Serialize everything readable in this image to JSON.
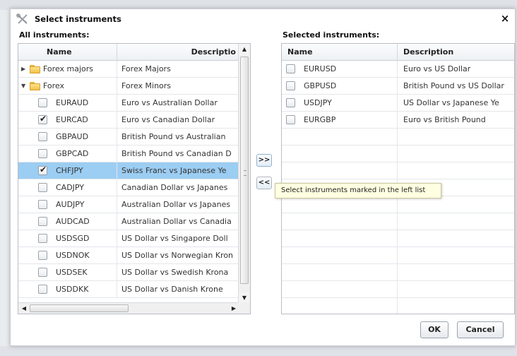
{
  "dialog": {
    "title": "Select instruments",
    "close_label": "×",
    "ok_label": "OK",
    "cancel_label": "Cancel"
  },
  "left": {
    "section_label": "All instruments:",
    "headers": {
      "name": "Name",
      "description": "Descriptio"
    },
    "rows": [
      {
        "kind": "group",
        "expanded": false,
        "name": "Forex majors",
        "description": "Forex Majors"
      },
      {
        "kind": "group",
        "expanded": true,
        "name": "Forex",
        "description": "Forex Minors"
      },
      {
        "kind": "item",
        "checked": false,
        "selected": false,
        "name": "EURAUD",
        "description": "Euro vs Australian Dollar"
      },
      {
        "kind": "item",
        "checked": true,
        "selected": false,
        "name": "EURCAD",
        "description": "Euro vs Canadian Dollar"
      },
      {
        "kind": "item",
        "checked": false,
        "selected": false,
        "name": "GBPAUD",
        "description": "British Pound vs Australian"
      },
      {
        "kind": "item",
        "checked": false,
        "selected": false,
        "name": "GBPCAD",
        "description": "British Pound vs Canadian D"
      },
      {
        "kind": "item",
        "checked": true,
        "selected": true,
        "name": "CHFJPY",
        "description": "Swiss Franc vs Japanese Ye"
      },
      {
        "kind": "item",
        "checked": false,
        "selected": false,
        "name": "CADJPY",
        "description": "Canadian Dollar vs Japanes"
      },
      {
        "kind": "item",
        "checked": false,
        "selected": false,
        "name": "AUDJPY",
        "description": "Australian Dollar vs Japanes"
      },
      {
        "kind": "item",
        "checked": false,
        "selected": false,
        "name": "AUDCAD",
        "description": "Australian Dollar vs Canadia"
      },
      {
        "kind": "item",
        "checked": false,
        "selected": false,
        "name": "USDSGD",
        "description": "US Dollar vs Singapore Doll"
      },
      {
        "kind": "item",
        "checked": false,
        "selected": false,
        "name": "USDNOK",
        "description": "US Dollar vs Norwegian Kron"
      },
      {
        "kind": "item",
        "checked": false,
        "selected": false,
        "name": "USDSEK",
        "description": "US Dollar vs Swedish Krona"
      },
      {
        "kind": "item",
        "checked": false,
        "selected": false,
        "name": "USDDKK",
        "description": "US Dollar vs Danish Krone"
      }
    ]
  },
  "right": {
    "section_label": "Selected instruments:",
    "headers": {
      "name": "Name",
      "description": "Description"
    },
    "rows": [
      {
        "checked": false,
        "name": "EURUSD",
        "description": "Euro vs US Dollar"
      },
      {
        "checked": false,
        "name": "GBPUSD",
        "description": "British Pound vs US Dollar"
      },
      {
        "checked": false,
        "name": "USDJPY",
        "description": "US Dollar vs Japanese Ye"
      },
      {
        "checked": false,
        "name": "EURGBP",
        "description": "Euro vs British Pound"
      }
    ],
    "empty_row_count": 11
  },
  "transfer": {
    "add_label": ">>",
    "remove_label": "<<",
    "tooltip": "Select instruments marked in the left list"
  },
  "icons": {
    "title": "tools-icon",
    "group": "folder-icon",
    "scroll_up": "arrow-up-icon",
    "scroll_down": "arrow-down-icon",
    "scroll_left": "arrow-left-icon",
    "scroll_right": "arrow-right-icon"
  },
  "colors": {
    "selected_row": "#9ccdf2",
    "tooltip_bg": "#ffffe1",
    "folder": "#f2c24a"
  }
}
